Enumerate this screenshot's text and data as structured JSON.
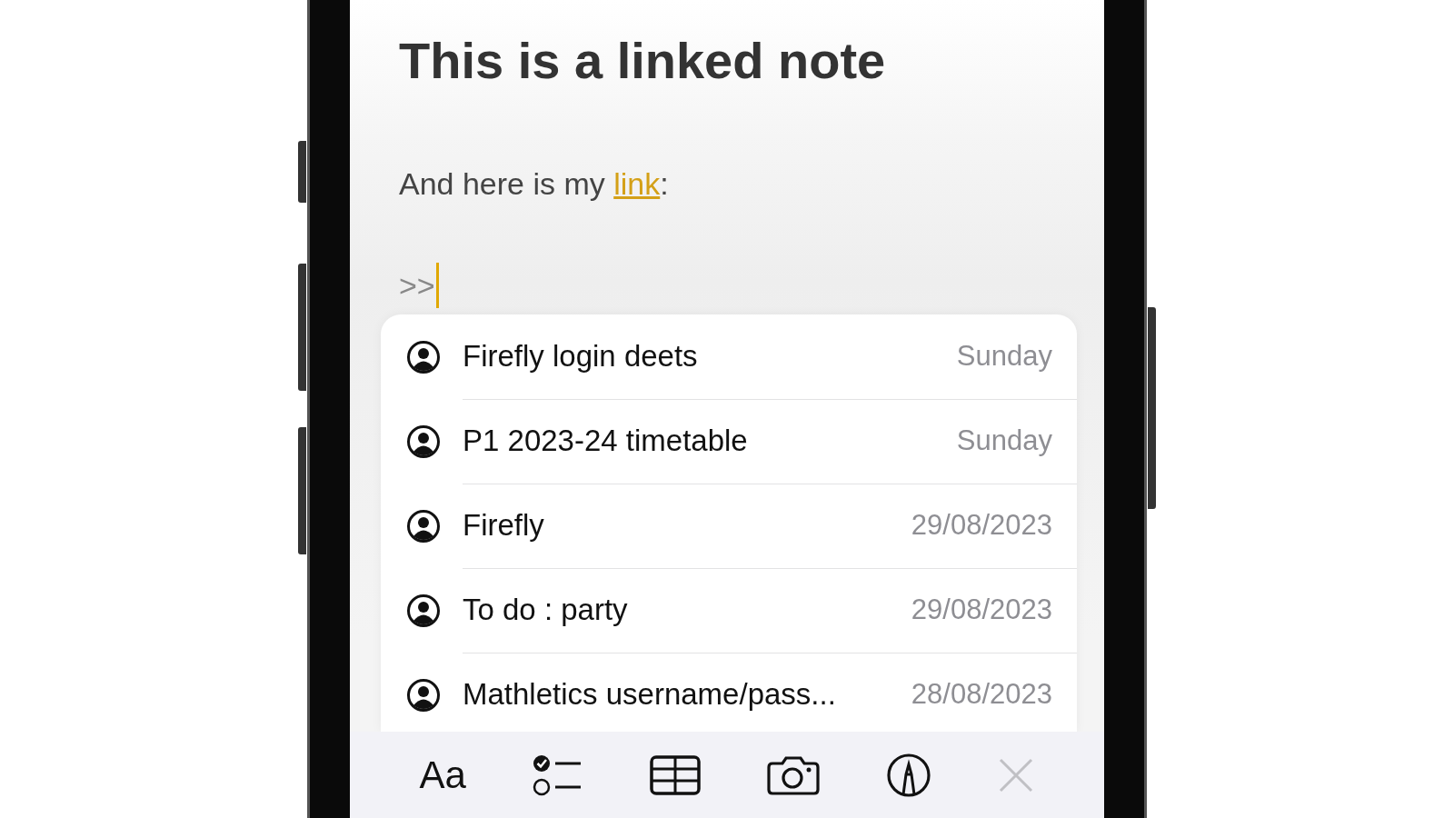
{
  "note": {
    "title": "This is a linked note",
    "body": {
      "prefix": "And here is my ",
      "link": "link",
      "suffix": ":"
    },
    "typed": ">>"
  },
  "suggestions": [
    {
      "title": "Firefly login deets",
      "date": "Sunday"
    },
    {
      "title": "P1 2023-24 timetable",
      "date": "Sunday"
    },
    {
      "title": "Firefly",
      "date": "29/08/2023"
    },
    {
      "title": "To do : party",
      "date": "29/08/2023"
    },
    {
      "title": "Mathletics username/pass...",
      "date": "28/08/2023"
    }
  ],
  "toolbar": [
    {
      "kind": "text",
      "label": "Aa",
      "disabled": false
    },
    {
      "kind": "checklist",
      "disabled": false
    },
    {
      "kind": "table",
      "disabled": false
    },
    {
      "kind": "camera",
      "disabled": false
    },
    {
      "kind": "markup",
      "disabled": false
    },
    {
      "kind": "close",
      "disabled": true
    }
  ]
}
